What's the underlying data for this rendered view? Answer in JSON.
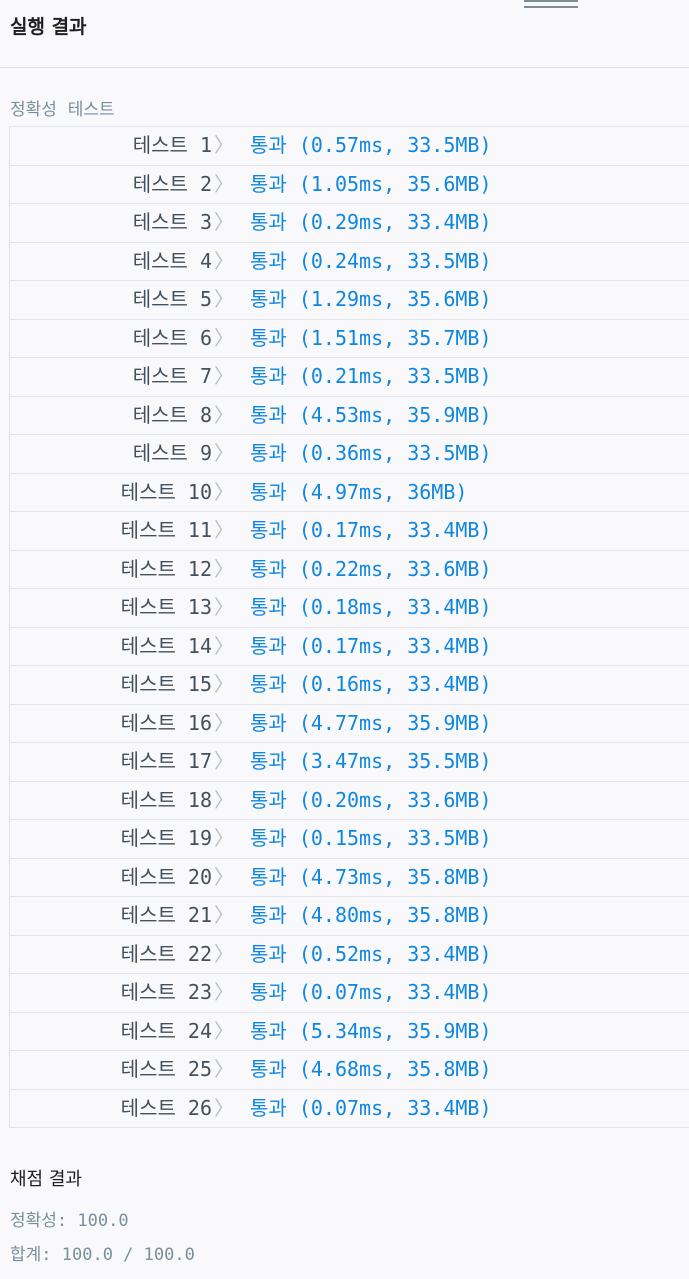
{
  "header": {
    "title": "실행 결과"
  },
  "section_label": "정확성  테스트",
  "tests": [
    {
      "label": "테스트 1",
      "result": "통과 (0.57ms, 33.5MB)"
    },
    {
      "label": "테스트 2",
      "result": "통과 (1.05ms, 35.6MB)"
    },
    {
      "label": "테스트 3",
      "result": "통과 (0.29ms, 33.4MB)"
    },
    {
      "label": "테스트 4",
      "result": "통과 (0.24ms, 33.5MB)"
    },
    {
      "label": "테스트 5",
      "result": "통과 (1.29ms, 35.6MB)"
    },
    {
      "label": "테스트 6",
      "result": "통과 (1.51ms, 35.7MB)"
    },
    {
      "label": "테스트 7",
      "result": "통과 (0.21ms, 33.5MB)"
    },
    {
      "label": "테스트 8",
      "result": "통과 (4.53ms, 35.9MB)"
    },
    {
      "label": "테스트 9",
      "result": "통과 (0.36ms, 33.5MB)"
    },
    {
      "label": "테스트 10",
      "result": "통과 (4.97ms, 36MB)"
    },
    {
      "label": "테스트 11",
      "result": "통과 (0.17ms, 33.4MB)"
    },
    {
      "label": "테스트 12",
      "result": "통과 (0.22ms, 33.6MB)"
    },
    {
      "label": "테스트 13",
      "result": "통과 (0.18ms, 33.4MB)"
    },
    {
      "label": "테스트 14",
      "result": "통과 (0.17ms, 33.4MB)"
    },
    {
      "label": "테스트 15",
      "result": "통과 (0.16ms, 33.4MB)"
    },
    {
      "label": "테스트 16",
      "result": "통과 (4.77ms, 35.9MB)"
    },
    {
      "label": "테스트 17",
      "result": "통과 (3.47ms, 35.5MB)"
    },
    {
      "label": "테스트 18",
      "result": "통과 (0.20ms, 33.6MB)"
    },
    {
      "label": "테스트 19",
      "result": "통과 (0.15ms, 33.5MB)"
    },
    {
      "label": "테스트 20",
      "result": "통과 (4.73ms, 35.8MB)"
    },
    {
      "label": "테스트 21",
      "result": "통과 (4.80ms, 35.8MB)"
    },
    {
      "label": "테스트 22",
      "result": "통과 (0.52ms, 33.4MB)"
    },
    {
      "label": "테스트 23",
      "result": "통과 (0.07ms, 33.4MB)"
    },
    {
      "label": "테스트 24",
      "result": "통과 (5.34ms, 35.9MB)"
    },
    {
      "label": "테스트 25",
      "result": "통과 (4.68ms, 35.8MB)"
    },
    {
      "label": "테스트 26",
      "result": "통과 (0.07ms, 33.4MB)"
    }
  ],
  "score": {
    "title": "채점 결과",
    "accuracy": "정확성: 100.0",
    "total": "합계: 100.0 / 100.0"
  },
  "colors": {
    "pass": "#0f86e0",
    "label": "#44505b",
    "muted": "#78909c"
  },
  "icons": {
    "row_chevron": "chevron-right-icon"
  }
}
